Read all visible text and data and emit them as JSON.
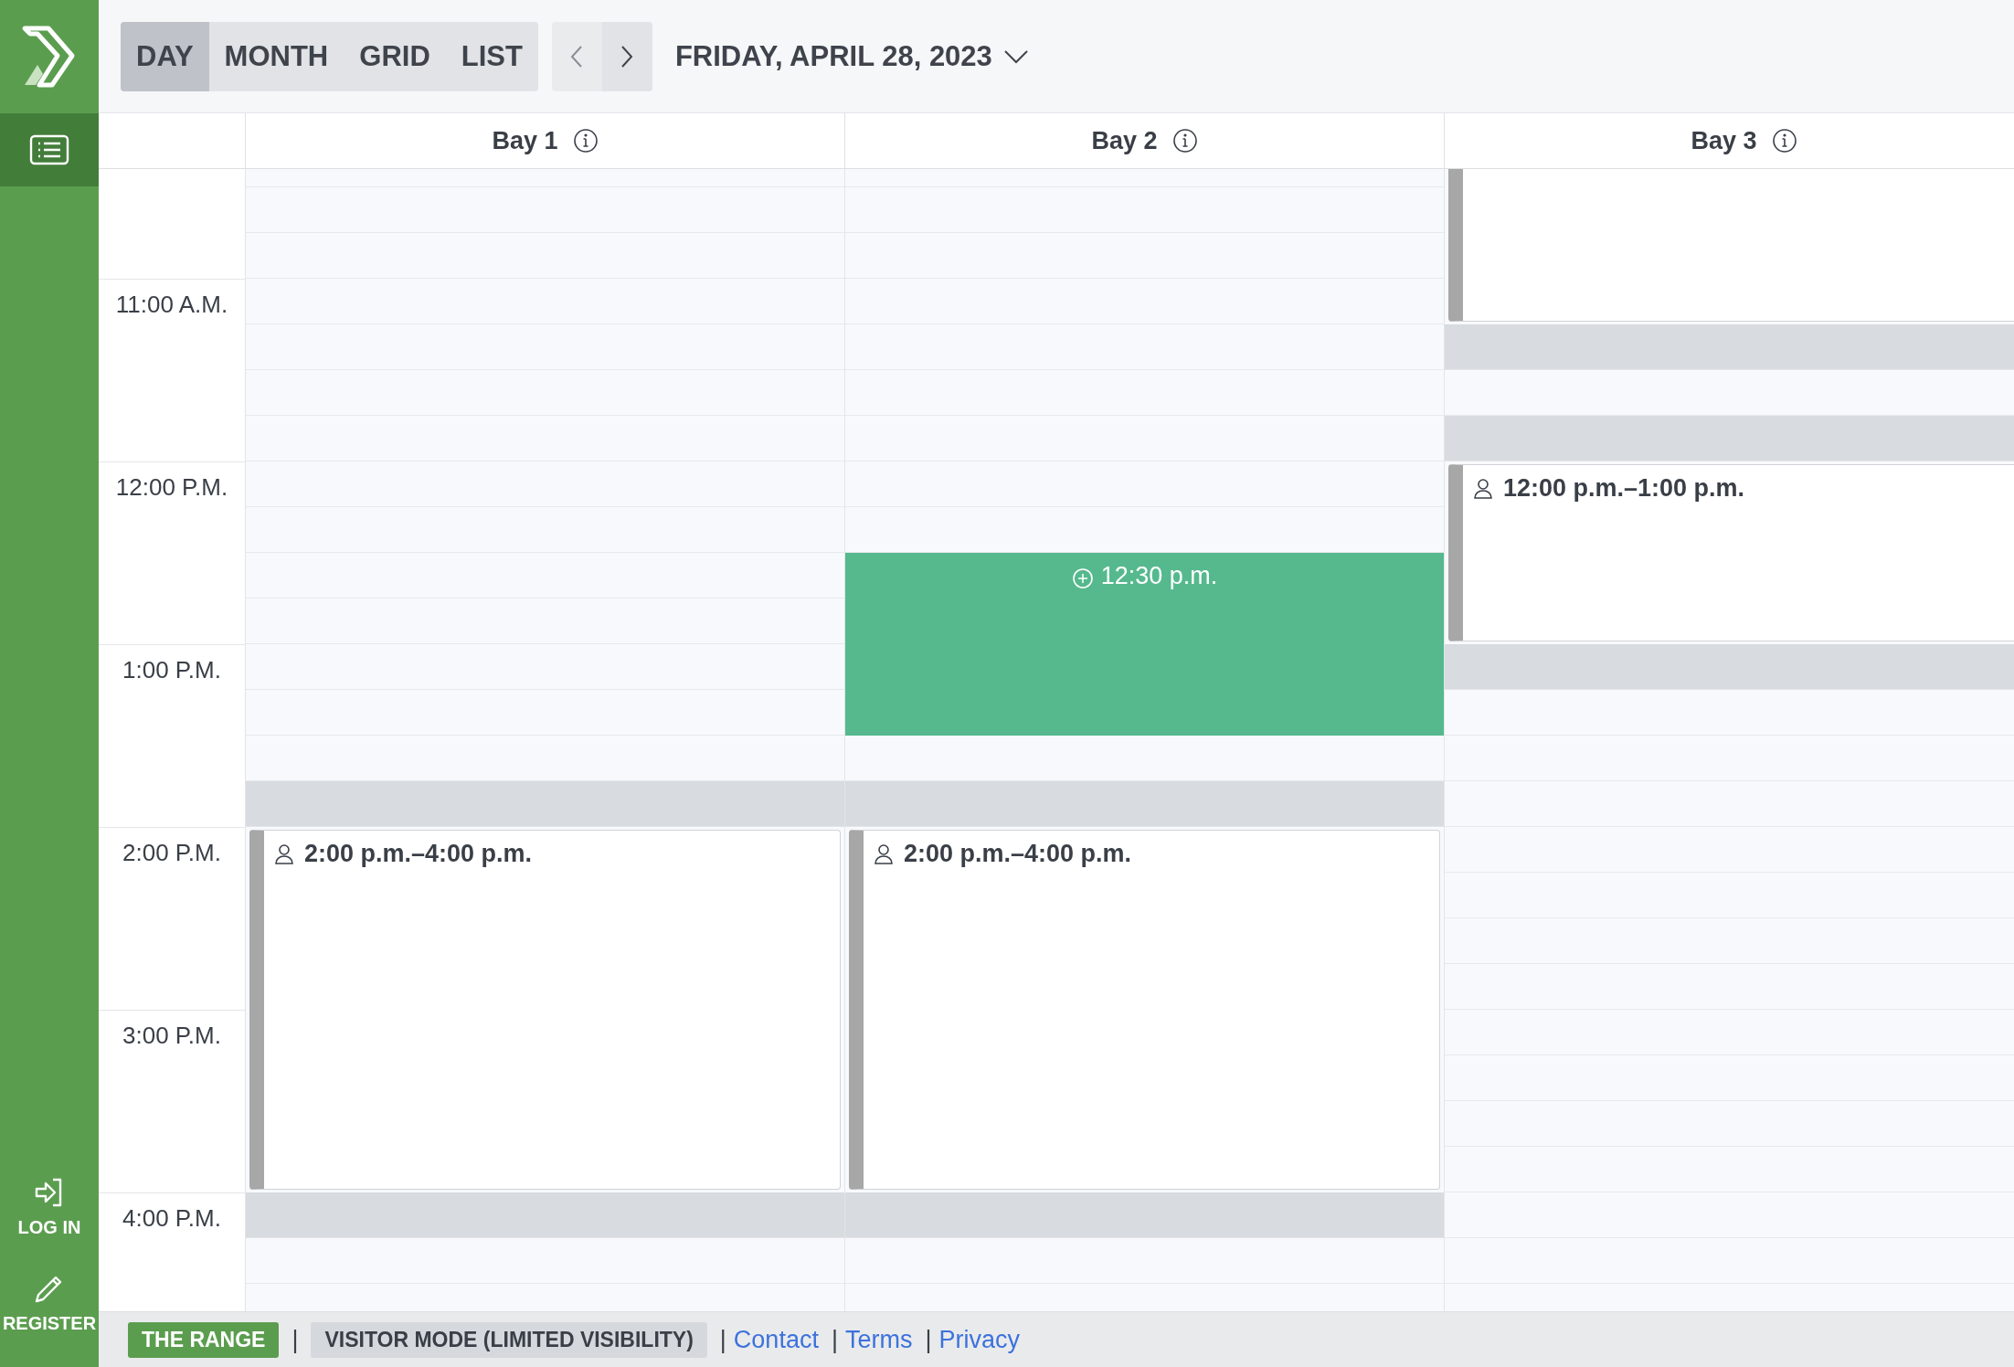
{
  "sidebar": {
    "list_button": {
      "selected": true
    },
    "actions": [
      {
        "kind": "login",
        "label": "LOG IN"
      },
      {
        "kind": "register",
        "label": "REGISTER"
      }
    ]
  },
  "toolbar": {
    "views": [
      {
        "label": "DAY",
        "selected": true
      },
      {
        "label": "MONTH",
        "selected": false
      },
      {
        "label": "GRID",
        "selected": false
      },
      {
        "label": "LIST",
        "selected": false
      }
    ],
    "prev": {
      "disabled": true
    },
    "next": {
      "disabled": false
    },
    "date": "FRIDAY, APRIL 28, 2023"
  },
  "bays": [
    {
      "name": "Bay 1"
    },
    {
      "name": "Bay 2"
    },
    {
      "name": "Bay 3"
    }
  ],
  "rows": [
    {
      "cells": [
        {
          "kind": "free"
        },
        {
          "kind": "free"
        },
        {
          "kind": "booked"
        }
      ]
    },
    {
      "cells": [
        {
          "kind": "free"
        },
        {
          "kind": "free"
        },
        {
          "kind": "booked"
        }
      ]
    },
    {
      "cells": [
        {
          "kind": "free"
        },
        {
          "kind": "free"
        },
        {
          "kind": "booked"
        }
      ]
    },
    {
      "time": "11:00 A.M.",
      "cells": [
        {
          "kind": "free"
        },
        {
          "kind": "free"
        },
        {
          "kind": "booked"
        }
      ]
    },
    {
      "cells": [
        {
          "kind": "free"
        },
        {
          "kind": "free"
        },
        {
          "kind": "unavailable"
        }
      ]
    },
    {
      "cells": [
        {
          "kind": "free"
        },
        {
          "kind": "free"
        },
        {
          "kind": "free"
        }
      ]
    },
    {
      "cells": [
        {
          "kind": "free"
        },
        {
          "kind": "free"
        },
        {
          "kind": "unavailable"
        }
      ]
    },
    {
      "time": "12:00 P.M.",
      "cells": [
        {
          "kind": "free"
        },
        {
          "kind": "free"
        },
        {
          "kind": "booked",
          "label": "12:00 p.m.–1:00 p.m."
        }
      ]
    },
    {
      "cells": [
        {
          "kind": "free"
        },
        {
          "kind": "free"
        },
        {
          "kind": "booked"
        }
      ]
    },
    {
      "cells": [
        {
          "kind": "free"
        },
        {
          "kind": "selected",
          "label": "12:30 p.m."
        },
        {
          "kind": "booked"
        }
      ]
    },
    {
      "cells": [
        {
          "kind": "free"
        },
        {
          "kind": "selected"
        },
        {
          "kind": "booked"
        }
      ]
    },
    {
      "time": "1:00 P.M.",
      "cells": [
        {
          "kind": "free"
        },
        {
          "kind": "selected"
        },
        {
          "kind": "unavailable"
        }
      ]
    },
    {
      "cells": [
        {
          "kind": "free"
        },
        {
          "kind": "selected"
        },
        {
          "kind": "free"
        }
      ]
    },
    {
      "cells": [
        {
          "kind": "free"
        },
        {
          "kind": "free"
        },
        {
          "kind": "free"
        }
      ]
    },
    {
      "cells": [
        {
          "kind": "unavailable"
        },
        {
          "kind": "unavailable"
        },
        {
          "kind": "free"
        }
      ]
    },
    {
      "time": "2:00 P.M.",
      "cells": [
        {
          "kind": "booked",
          "label": "2:00 p.m.–4:00 p.m."
        },
        {
          "kind": "booked",
          "label": "2:00 p.m.–4:00 p.m."
        },
        {
          "kind": "free"
        }
      ]
    },
    {
      "cells": [
        {
          "kind": "booked"
        },
        {
          "kind": "booked"
        },
        {
          "kind": "free"
        }
      ]
    },
    {
      "cells": [
        {
          "kind": "booked"
        },
        {
          "kind": "booked"
        },
        {
          "kind": "free"
        }
      ]
    },
    {
      "cells": [
        {
          "kind": "booked"
        },
        {
          "kind": "booked"
        },
        {
          "kind": "free"
        }
      ]
    },
    {
      "time": "3:00 P.M.",
      "cells": [
        {
          "kind": "booked"
        },
        {
          "kind": "booked"
        },
        {
          "kind": "free"
        }
      ]
    },
    {
      "cells": [
        {
          "kind": "booked"
        },
        {
          "kind": "booked"
        },
        {
          "kind": "free"
        }
      ]
    },
    {
      "cells": [
        {
          "kind": "booked"
        },
        {
          "kind": "booked"
        },
        {
          "kind": "free"
        }
      ]
    },
    {
      "cells": [
        {
          "kind": "booked"
        },
        {
          "kind": "booked"
        },
        {
          "kind": "free"
        }
      ]
    },
    {
      "time": "4:00 P.M.",
      "cells": [
        {
          "kind": "unavailable"
        },
        {
          "kind": "unavailable"
        },
        {
          "kind": "free"
        }
      ]
    },
    {
      "cells": [
        {
          "kind": "free"
        },
        {
          "kind": "free"
        },
        {
          "kind": "free"
        }
      ]
    },
    {
      "cells": [
        {
          "kind": "free"
        },
        {
          "kind": "free"
        },
        {
          "kind": "free"
        }
      ]
    }
  ],
  "footer": [
    {
      "kind": "brand",
      "text": "THE RANGE"
    },
    {
      "kind": "separator",
      "text": "|"
    },
    {
      "kind": "badge",
      "text": "VISITOR MODE (LIMITED VISIBILITY)"
    },
    {
      "kind": "separator",
      "text": "|"
    },
    {
      "kind": "link",
      "text": "Contact"
    },
    {
      "kind": "separator",
      "text": "|"
    },
    {
      "kind": "link",
      "text": "Terms"
    },
    {
      "kind": "separator",
      "text": "|"
    },
    {
      "kind": "link",
      "text": "Privacy"
    }
  ]
}
